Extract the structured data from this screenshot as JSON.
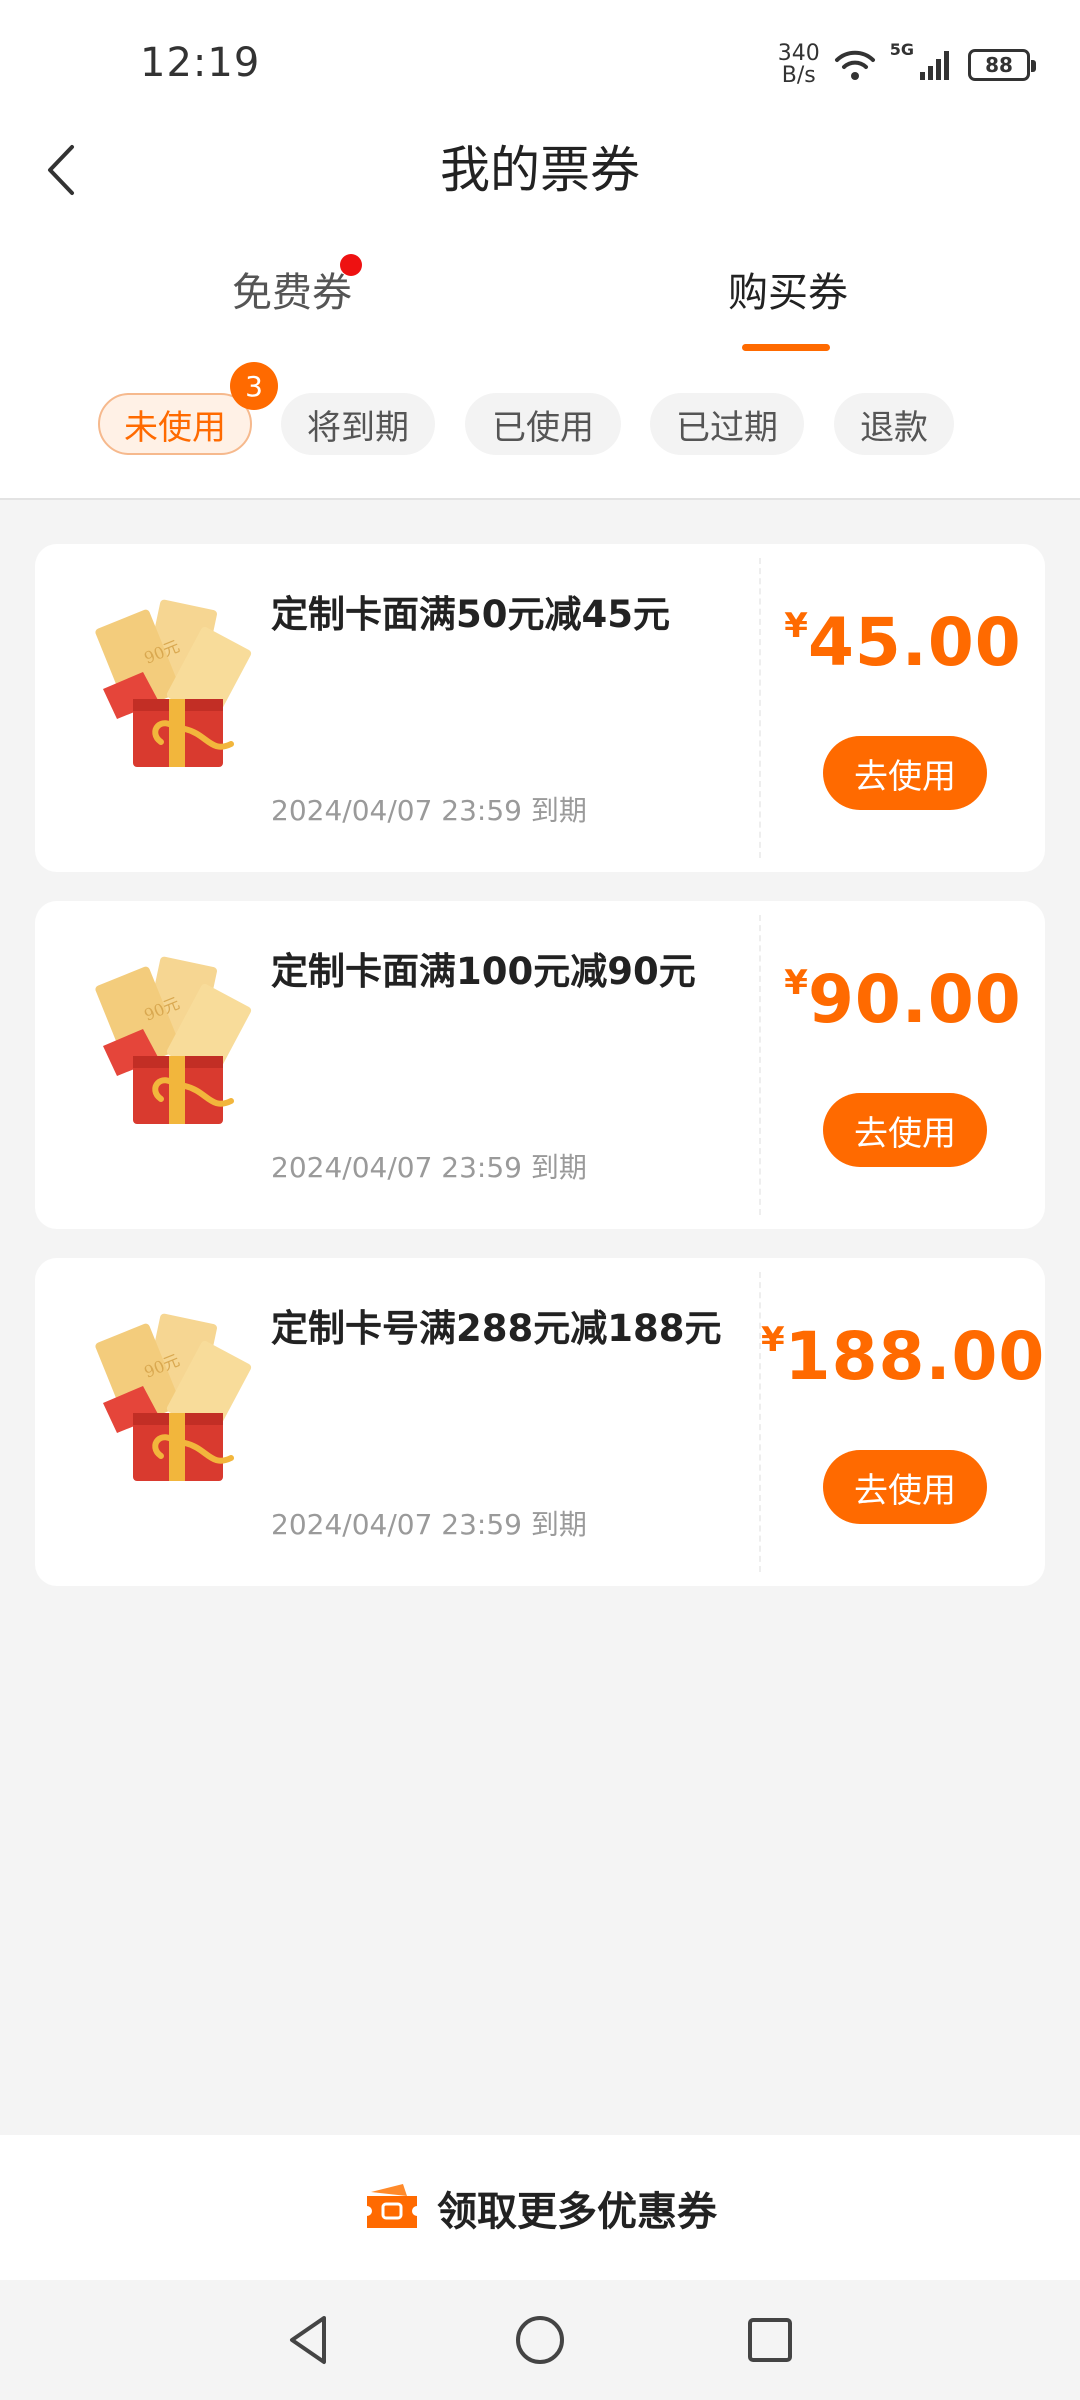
{
  "status_bar": {
    "time": "12:19",
    "net_speed_value": "340",
    "net_speed_unit": "B/s",
    "network_type": "5G",
    "battery": "88",
    "icons": [
      "wifi-icon",
      "signal-icon",
      "battery-icon"
    ]
  },
  "header": {
    "title": "我的票券",
    "back_icon": "chevron-left-icon"
  },
  "tabs": [
    {
      "label": "免费券",
      "has_dot": true,
      "active": false
    },
    {
      "label": "购买券",
      "active": true
    }
  ],
  "filters": [
    {
      "label": "未使用",
      "active": true,
      "badge": "3"
    },
    {
      "label": "将到期"
    },
    {
      "label": "已使用"
    },
    {
      "label": "已过期"
    },
    {
      "label": "退款"
    }
  ],
  "coupons": [
    {
      "title": "定制卡面满50元减45元",
      "currency": "¥",
      "amount": "45.00",
      "expiry": "2024/04/07 23:59 到期",
      "button": "去使用"
    },
    {
      "title": "定制卡面满100元减90元",
      "currency": "¥",
      "amount": "90.00",
      "expiry": "2024/04/07 23:59 到期",
      "button": "去使用"
    },
    {
      "title": "定制卡号满288元减188元",
      "currency": "¥",
      "amount": "188.00",
      "expiry": "2024/04/07 23:59 到期",
      "button": "去使用"
    }
  ],
  "footer": {
    "more_coupons": "领取更多优惠券",
    "icon": "ticket-icon"
  },
  "nav_bar": {
    "icons": [
      "back-triangle-icon",
      "home-circle-icon",
      "recents-square-icon"
    ]
  },
  "colors": {
    "accent": "#ff6a00",
    "dot": "#ee1111",
    "background": "#f4f4f4"
  }
}
